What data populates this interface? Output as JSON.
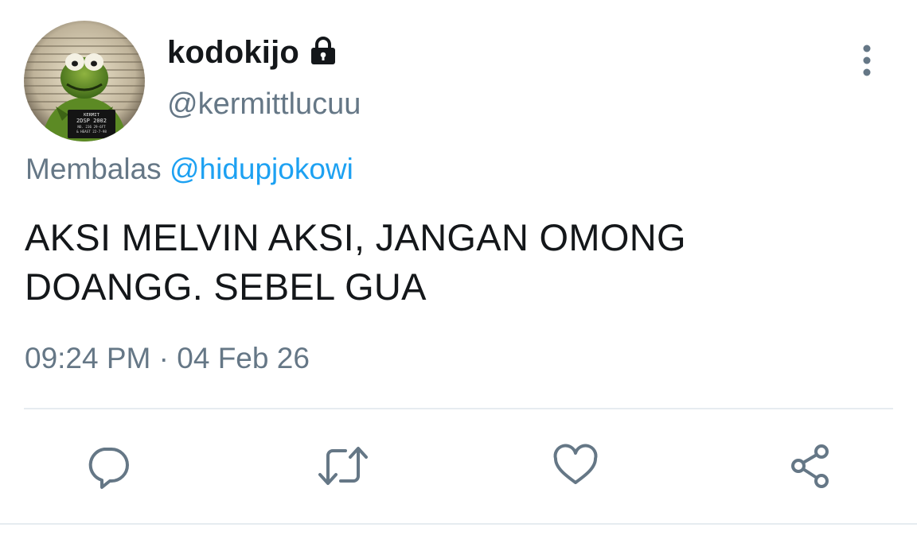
{
  "user": {
    "display_name": "kodokijo",
    "handle": "@kermittlucuu",
    "verified_icon": "lock-icon",
    "avatar_sign_text": [
      "KERMIT",
      "2DSP 2002",
      "NO. 236   29-6FT",
      "& HEAST   22-7-98"
    ]
  },
  "reply": {
    "prefix": "Membalas",
    "mention": "@hidupjokowi"
  },
  "tweet": {
    "text": "AKSI MELVIN AKSI, JANGAN OMONG\nDOANGG. SEBEL GUA"
  },
  "meta": {
    "time": "09:24 PM",
    "separator": "·",
    "date": "04 Feb 26"
  },
  "actions": [
    {
      "icon": "reply-icon"
    },
    {
      "icon": "retweet-icon"
    },
    {
      "icon": "like-icon"
    },
    {
      "icon": "share-icon"
    }
  ],
  "colors": {
    "text_primary": "#14171a",
    "text_secondary": "#657786",
    "link": "#1da1f2",
    "icon": "#657786",
    "divider": "#e6ecf0"
  }
}
